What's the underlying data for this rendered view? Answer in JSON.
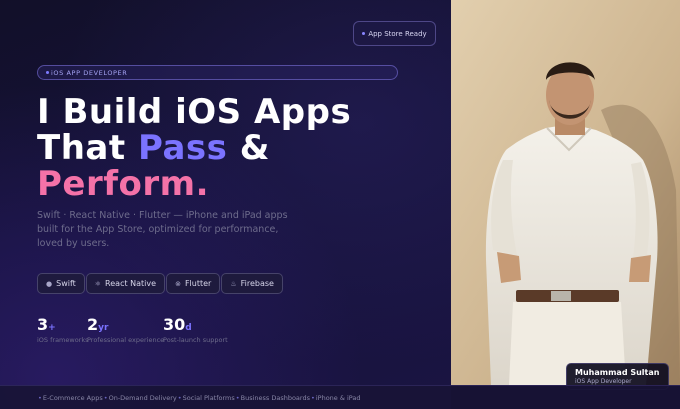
{
  "header": {
    "store_badge": "App Store Ready"
  },
  "hero": {
    "tag": "iOS APP DEVELOPER",
    "line1": "I Build iOS Apps",
    "line2_a": "That ",
    "line2_accent": "Pass",
    "line2_b": " &",
    "line3": "Perform.",
    "description": "Swift · React Native · Flutter — iPhone and iPad apps built for the App Store, optimized for performance, loved by users."
  },
  "chips": [
    {
      "icon": "apple-icon",
      "glyph": "",
      "label": "Swift"
    },
    {
      "icon": "atom-icon",
      "glyph": "⚛",
      "label": "React Native"
    },
    {
      "icon": "flutter-icon",
      "glyph": "⊗",
      "label": "Flutter"
    },
    {
      "icon": "flame-icon",
      "glyph": "♨",
      "label": "Firebase"
    }
  ],
  "stats": [
    {
      "value": "3",
      "suffix": "+",
      "label": "iOS frameworks"
    },
    {
      "value": "2",
      "suffix": "yr",
      "label": "Professional experience"
    },
    {
      "value": "30",
      "suffix": "d",
      "label": "Post-launch support"
    }
  ],
  "ticker": [
    "E-Commerce Apps",
    "On-Demand Delivery",
    "Social Platforms",
    "Business Dashboards",
    "iPhone & iPad"
  ],
  "profile": {
    "name": "Muhammad Sultan",
    "role": "iOS App Developer"
  },
  "colors": {
    "accent": "#7b73ff",
    "pink": "#f472a8",
    "background": "#0d0b1f"
  }
}
